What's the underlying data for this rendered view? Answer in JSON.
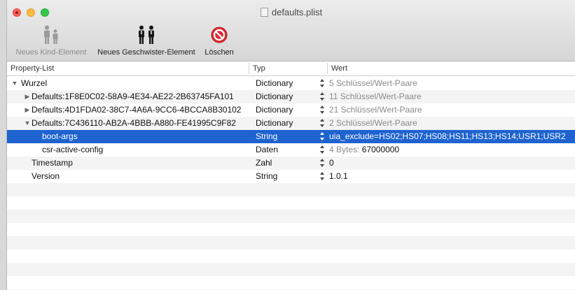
{
  "window": {
    "title": "defaults.plist"
  },
  "toolbar": {
    "new_child_label": "Neues Kind-Element",
    "new_sibling_label": "Neues Geschwister-Element",
    "delete_label": "Löschen"
  },
  "columns": {
    "key": "Property-List",
    "type": "Typ",
    "value": "Wert"
  },
  "rows": [
    {
      "key": "Wurzel",
      "type": "Dictionary",
      "value": "5 Schlüssel/Wert-Paare"
    },
    {
      "key": "Defaults:1F8E0C02-58A9-4E34-AE22-2B63745FA101",
      "type": "Dictionary",
      "value": "11 Schlüssel/Wert-Paare"
    },
    {
      "key": "Defaults:4D1FDA02-38C7-4A6A-9CC6-4BCCA8B30102",
      "type": "Dictionary",
      "value": "21 Schlüssel/Wert-Paare"
    },
    {
      "key": "Defaults:7C436110-AB2A-4BBB-A880-FE41995C9F82",
      "type": "Dictionary",
      "value": "2 Schlüssel/Wert-Paare"
    },
    {
      "key": "boot-args",
      "type": "String",
      "value": "uia_exclude=HS02;HS07;HS08;HS11;HS13;HS14;USR1;USR2"
    },
    {
      "key": "csr-active-config",
      "type": "Daten",
      "value_prefix": "4 Bytes:",
      "value": "67000000"
    },
    {
      "key": "Timestamp",
      "type": "Zahl",
      "value": "0"
    },
    {
      "key": "Version",
      "type": "String",
      "value": "1.0.1"
    }
  ],
  "colors": {
    "selection": "#1e63cf",
    "close": "#fc605c",
    "minimize": "#fdbc40",
    "maximize": "#34c84a",
    "delete_icon": "#e0282e"
  }
}
